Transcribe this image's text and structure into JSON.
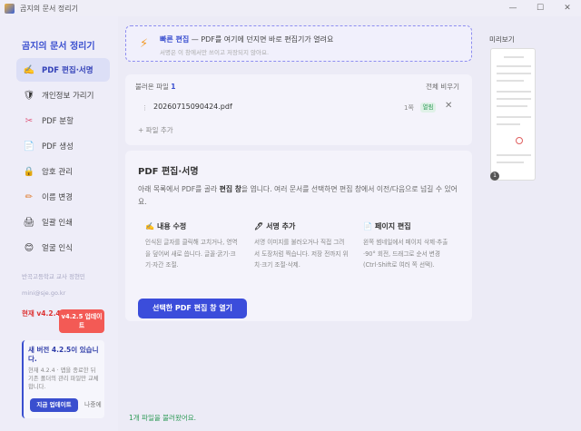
{
  "window": {
    "title": "곰지의 문서 정리기",
    "minimize": "—",
    "maximize": "☐",
    "close": "✕"
  },
  "sidebar": {
    "brand": "곰지의 문서 정리기",
    "items": [
      {
        "label": "PDF 편집·서명",
        "icon": "✍️"
      },
      {
        "label": "개인정보 가리기",
        "icon": "🛡"
      },
      {
        "label": "PDF 분할",
        "icon": "✂"
      },
      {
        "label": "PDF 생성",
        "icon": "📄"
      },
      {
        "label": "암호 관리",
        "icon": "🔒"
      },
      {
        "label": "이름 변경",
        "icon": "✏"
      },
      {
        "label": "일괄 인쇄",
        "icon": "🖨"
      },
      {
        "label": "얼굴 인식",
        "icon": "😊"
      }
    ],
    "org": "반곡고등학교 교사 정현민",
    "email": "mini@sje.go.kr",
    "current_version": "현재 v4.2.4",
    "update_badge": "v4.2.5 업데이트",
    "update_card": {
      "title": "새 버전 4.2.5이 있습니다.",
      "desc": "현재 4.2.4 · 앱을 종료한 뒤 기존 폴더의 관리 파일만 교체합니다.",
      "update_now": "지금 업데이트",
      "later": "나중에"
    }
  },
  "quick": {
    "title": "빠른 편집",
    "title_rest": " — PDF를 여기에 던지면 바로 편집기가 열려요",
    "subtitle": "서명은 이 창에서만 쓰이고 저장되지 않아요."
  },
  "files": {
    "header_label": "불러온 파일",
    "count": "1",
    "clear_all": "전체 비우기",
    "items": [
      {
        "name": "20260715090424.pdf",
        "pages": "1쪽",
        "status": "열림"
      }
    ],
    "add": "+ 파일 추가"
  },
  "panel": {
    "title": "PDF 편집·서명",
    "desc_a": "아래 목록에서 PDF를 골라 ",
    "desc_b": "편집 창",
    "desc_c": "을 엽니다. 여러 문서를 선택하면 편집 창에서 이전/다음으로 넘길 수 있어요.",
    "features": [
      {
        "icon": "✍️",
        "title": "내용 수정",
        "desc": "인식된 글자를 클릭해 고치거나, 영역을 덮어써 새로 씁니다. 글꼴·굵기·크기·자간 조절."
      },
      {
        "icon": "🖊",
        "title": "서명 추가",
        "desc": "서명 이미지를 불러오거나 직접 그려서 도장처럼 찍습니다. 저장 전까지 위치·크기 조절·삭제."
      },
      {
        "icon": "📄",
        "title": "페이지 편집",
        "desc": "왼쪽 썸네일에서 페이지 삭제·추출·90° 회전, 드래그로 순서 변경(Ctrl·Shift로 여러 쪽 선택)."
      }
    ],
    "open_button": "선택한 PDF 편집 창 열기"
  },
  "status": "1개 파일을 불러왔어요.",
  "preview": {
    "label": "미리보기",
    "page_number": "1"
  }
}
